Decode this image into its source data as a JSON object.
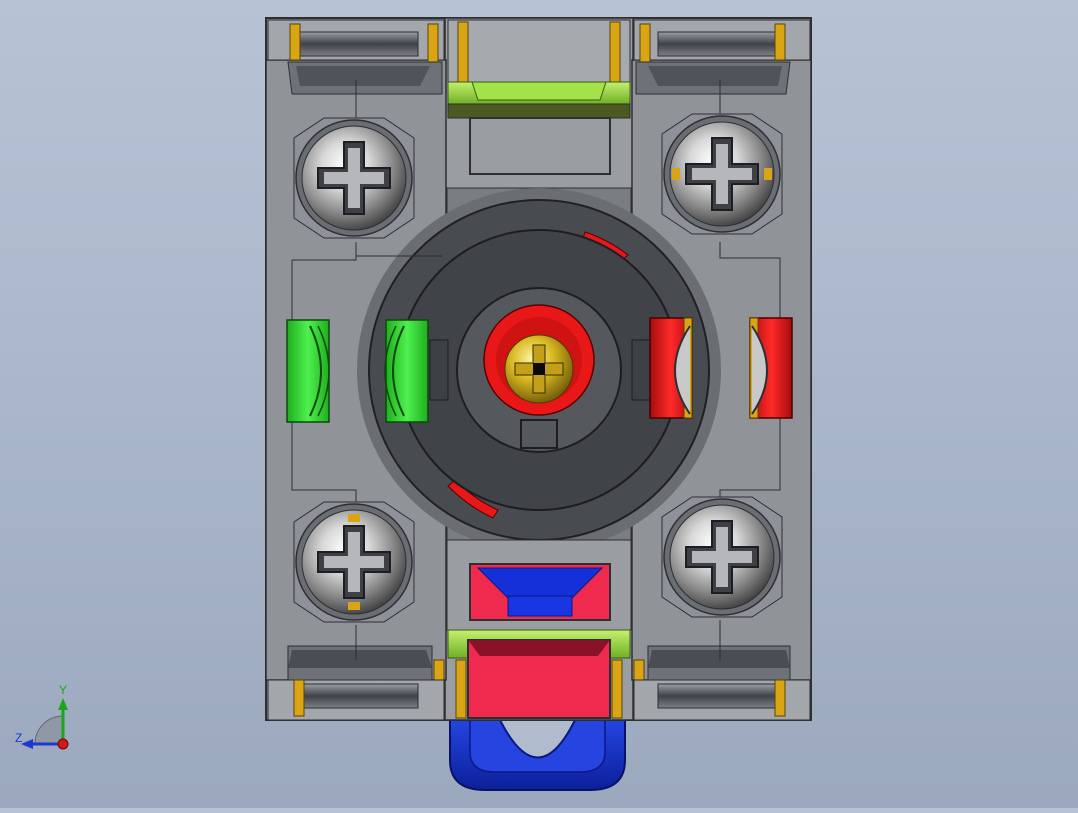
{
  "viewport": {
    "background_top": "#b7c3d5",
    "background_bottom": "#9ba8bd"
  },
  "model": {
    "body_color": "#8e9197",
    "body_dark": "#5f6268",
    "rail_color": "#5d6066",
    "left_contact_color": "#2fd12f",
    "right_contact_color": "#e01616",
    "top_latch_color": "#93d83a",
    "bottom_actuator_color": "#f02a4e",
    "clip_color": "#2038d8",
    "screw_head_color": "#c8b422",
    "gold_pin_color": "#d9a514",
    "screws": [
      {
        "name": "top-left",
        "icon": "phillips-screw-icon"
      },
      {
        "name": "top-right",
        "icon": "phillips-screw-icon"
      },
      {
        "name": "bottom-left",
        "icon": "phillips-screw-icon"
      },
      {
        "name": "bottom-right",
        "icon": "phillips-screw-icon"
      }
    ]
  },
  "triad": {
    "y_label": "Y",
    "z_label": "Z",
    "y_color": "#1aa81a",
    "z_color": "#1a3ad1",
    "x_color": "#d11a1a"
  }
}
